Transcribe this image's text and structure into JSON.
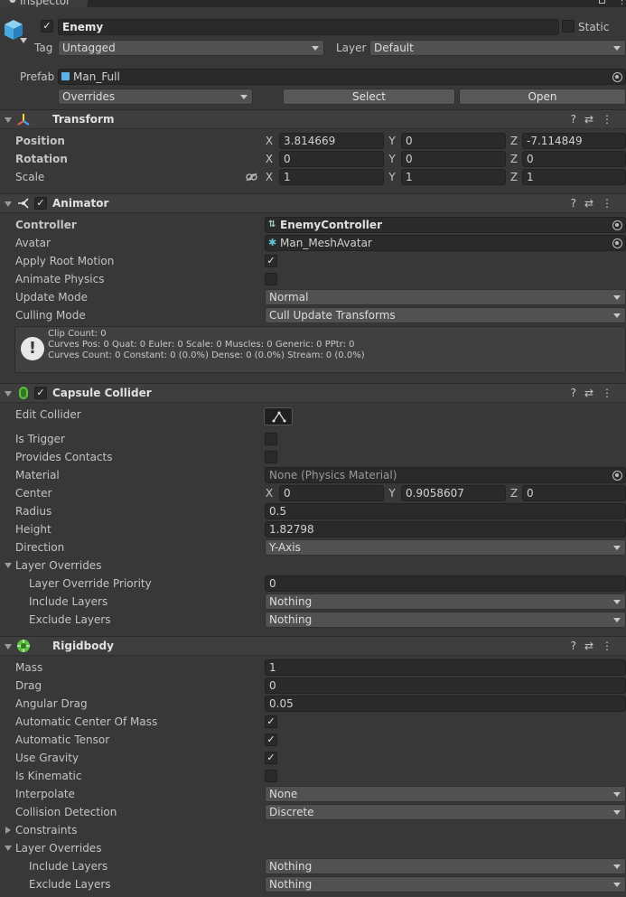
{
  "window": {
    "tab_title": "Inspector"
  },
  "object": {
    "name": "Enemy",
    "active": true,
    "static_label": "Static",
    "static": false,
    "tag_label": "Tag",
    "tag_value": "Untagged",
    "layer_label": "Layer",
    "layer_value": "Default",
    "prefab_label": "Prefab",
    "prefab_value": "Man_Full",
    "overrides_label": "Overrides",
    "select_label": "Select",
    "open_label": "Open"
  },
  "transform": {
    "title": "Transform",
    "position_label": "Position",
    "rotation_label": "Rotation",
    "scale_label": "Scale",
    "axis_x": "X",
    "axis_y": "Y",
    "axis_z": "Z",
    "position": {
      "x": "3.814669",
      "y": "0",
      "z": "-7.114849"
    },
    "rotation": {
      "x": "0",
      "y": "0",
      "z": "0"
    },
    "scale": {
      "x": "1",
      "y": "1",
      "z": "1"
    }
  },
  "animator": {
    "title": "Animator",
    "enabled": true,
    "controller_label": "Controller",
    "controller_value": "EnemyController",
    "avatar_label": "Avatar",
    "avatar_value": "Man_MeshAvatar",
    "apply_root_motion_label": "Apply Root Motion",
    "apply_root_motion": true,
    "animate_physics_label": "Animate Physics",
    "animate_physics": false,
    "update_mode_label": "Update Mode",
    "update_mode_value": "Normal",
    "culling_mode_label": "Culling Mode",
    "culling_mode_value": "Cull Update Transforms",
    "info_line1": "Clip Count: 0",
    "info_line2": "Curves Pos: 0 Quat: 0 Euler: 0 Scale: 0 Muscles: 0 Generic: 0 PPtr: 0",
    "info_line3": "Curves Count: 0 Constant: 0 (0.0%) Dense: 0 (0.0%) Stream: 0 (0.0%)"
  },
  "capsule": {
    "title": "Capsule Collider",
    "enabled": true,
    "edit_collider_label": "Edit Collider",
    "is_trigger_label": "Is Trigger",
    "is_trigger": false,
    "provides_contacts_label": "Provides Contacts",
    "provides_contacts": false,
    "material_label": "Material",
    "material_value": "None (Physics Material)",
    "center_label": "Center",
    "center": {
      "x": "0",
      "y": "0.9058607",
      "z": "0"
    },
    "radius_label": "Radius",
    "radius_value": "0.5",
    "height_label": "Height",
    "height_value": "1.82798",
    "direction_label": "Direction",
    "direction_value": "Y-Axis",
    "layer_overrides_label": "Layer Overrides",
    "layer_override_priority_label": "Layer Override Priority",
    "layer_override_priority_value": "0",
    "include_layers_label": "Include Layers",
    "include_layers_value": "Nothing",
    "exclude_layers_label": "Exclude Layers",
    "exclude_layers_value": "Nothing"
  },
  "rigidbody": {
    "title": "Rigidbody",
    "mass_label": "Mass",
    "mass_value": "1",
    "drag_label": "Drag",
    "drag_value": "0",
    "angular_drag_label": "Angular Drag",
    "angular_drag_value": "0.05",
    "auto_com_label": "Automatic Center Of Mass",
    "auto_com": true,
    "auto_tensor_label": "Automatic Tensor",
    "auto_tensor": true,
    "use_gravity_label": "Use Gravity",
    "use_gravity": true,
    "is_kinematic_label": "Is Kinematic",
    "is_kinematic": false,
    "interpolate_label": "Interpolate",
    "interpolate_value": "None",
    "collision_detection_label": "Collision Detection",
    "collision_detection_value": "Discrete",
    "constraints_label": "Constraints",
    "layer_overrides_label": "Layer Overrides",
    "include_layers_label": "Include Layers",
    "include_layers_value": "Nothing",
    "exclude_layers_label": "Exclude Layers",
    "exclude_layers_value": "Nothing"
  },
  "icons": {
    "check": "✓",
    "help": "?",
    "presets": "⇄",
    "menu": "⋮"
  }
}
